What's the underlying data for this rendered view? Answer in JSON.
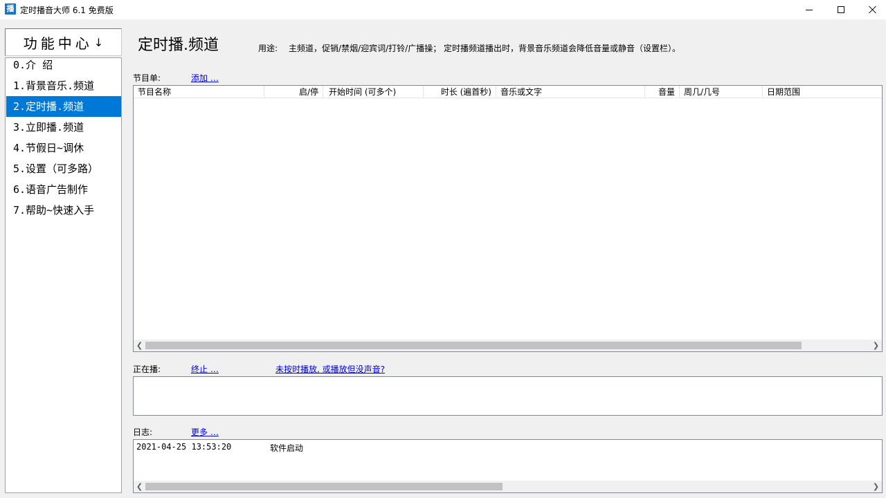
{
  "window": {
    "app_icon_glyph": "播",
    "title": "定时播音大师 6.1 免费版"
  },
  "sidebar": {
    "header": "功能中心",
    "header_arrow": "↓",
    "items": [
      {
        "label": "0.介 绍"
      },
      {
        "label": "1.背景音乐.频道"
      },
      {
        "label": "2.定时播.频道",
        "selected": true
      },
      {
        "label": "3.立即播.频道"
      },
      {
        "label": "4.节假日~调休"
      },
      {
        "label": "5.设置（可多路）"
      },
      {
        "label": "6.语音广告制作"
      },
      {
        "label": "7.帮助~快速入手"
      }
    ]
  },
  "main": {
    "title": "定时播.频道",
    "usage_label": "用途:",
    "usage_text": "主频道，促销/禁烟/迎宾词/打铃/广播操； 定时播频道播出时，背景音乐频道会降低音量或静音（设置栏）。"
  },
  "program_list": {
    "label": "节目单:",
    "add_link": "添加 …",
    "columns": [
      {
        "label": "节目名称"
      },
      {
        "label": "启/停"
      },
      {
        "label": "开始时间 (可多个)"
      },
      {
        "label": "时长 (遍首秒)"
      },
      {
        "label": "音乐或文字"
      },
      {
        "label": "音量"
      },
      {
        "label": "周几/几号"
      },
      {
        "label": "日期范围"
      }
    ],
    "rows": []
  },
  "now_playing": {
    "label": "正在播:",
    "stop_link": "终止 …",
    "help_link": "未按时播放, 或播放但没声音?"
  },
  "log": {
    "label": "日志:",
    "more_link": "更多 …",
    "entries": [
      {
        "time": "2021-04-25 13:53:20",
        "message": "软件启动"
      }
    ]
  },
  "icons": {
    "scroll_left": "scroll-left-arrow-icon",
    "scroll_right": "scroll-right-arrow-icon",
    "minimize": "minimize-icon",
    "maximize": "maximize-icon",
    "close": "close-icon"
  },
  "colors": {
    "selection": "#0078d7",
    "link": "#0000ee",
    "window_bg": "#f0f0f0"
  }
}
